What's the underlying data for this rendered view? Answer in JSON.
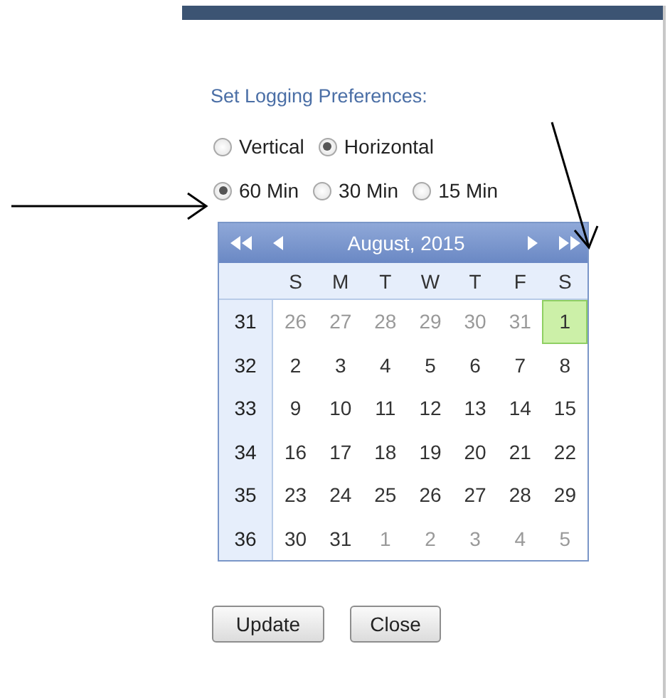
{
  "heading": "Set Logging Preferences:",
  "radio_rows": [
    [
      {
        "label": "Vertical",
        "selected": false
      },
      {
        "label": "Horizontal",
        "selected": true
      }
    ],
    [
      {
        "label": "60 Min",
        "selected": true
      },
      {
        "label": "30 Min",
        "selected": false
      },
      {
        "label": "15 Min",
        "selected": false
      }
    ]
  ],
  "calendar": {
    "title": "August, 2015",
    "weekdays": [
      "S",
      "M",
      "T",
      "W",
      "T",
      "F",
      "S"
    ],
    "weeks": [
      {
        "number": "31",
        "days": [
          {
            "day": "26",
            "other_month": true,
            "selected": false
          },
          {
            "day": "27",
            "other_month": true,
            "selected": false
          },
          {
            "day": "28",
            "other_month": true,
            "selected": false
          },
          {
            "day": "29",
            "other_month": true,
            "selected": false
          },
          {
            "day": "30",
            "other_month": true,
            "selected": false
          },
          {
            "day": "31",
            "other_month": true,
            "selected": false
          },
          {
            "day": "1",
            "other_month": false,
            "selected": true
          }
        ]
      },
      {
        "number": "32",
        "days": [
          {
            "day": "2",
            "other_month": false,
            "selected": false
          },
          {
            "day": "3",
            "other_month": false,
            "selected": false
          },
          {
            "day": "4",
            "other_month": false,
            "selected": false
          },
          {
            "day": "5",
            "other_month": false,
            "selected": false
          },
          {
            "day": "6",
            "other_month": false,
            "selected": false
          },
          {
            "day": "7",
            "other_month": false,
            "selected": false
          },
          {
            "day": "8",
            "other_month": false,
            "selected": false
          }
        ]
      },
      {
        "number": "33",
        "days": [
          {
            "day": "9",
            "other_month": false,
            "selected": false
          },
          {
            "day": "10",
            "other_month": false,
            "selected": false
          },
          {
            "day": "11",
            "other_month": false,
            "selected": false
          },
          {
            "day": "12",
            "other_month": false,
            "selected": false
          },
          {
            "day": "13",
            "other_month": false,
            "selected": false
          },
          {
            "day": "14",
            "other_month": false,
            "selected": false
          },
          {
            "day": "15",
            "other_month": false,
            "selected": false
          }
        ]
      },
      {
        "number": "34",
        "days": [
          {
            "day": "16",
            "other_month": false,
            "selected": false
          },
          {
            "day": "17",
            "other_month": false,
            "selected": false
          },
          {
            "day": "18",
            "other_month": false,
            "selected": false
          },
          {
            "day": "19",
            "other_month": false,
            "selected": false
          },
          {
            "day": "20",
            "other_month": false,
            "selected": false
          },
          {
            "day": "21",
            "other_month": false,
            "selected": false
          },
          {
            "day": "22",
            "other_month": false,
            "selected": false
          }
        ]
      },
      {
        "number": "35",
        "days": [
          {
            "day": "23",
            "other_month": false,
            "selected": false
          },
          {
            "day": "24",
            "other_month": false,
            "selected": false
          },
          {
            "day": "25",
            "other_month": false,
            "selected": false
          },
          {
            "day": "26",
            "other_month": false,
            "selected": false
          },
          {
            "day": "27",
            "other_month": false,
            "selected": false
          },
          {
            "day": "28",
            "other_month": false,
            "selected": false
          },
          {
            "day": "29",
            "other_month": false,
            "selected": false
          }
        ]
      },
      {
        "number": "36",
        "days": [
          {
            "day": "30",
            "other_month": false,
            "selected": false
          },
          {
            "day": "31",
            "other_month": false,
            "selected": false
          },
          {
            "day": "1",
            "other_month": true,
            "selected": false
          },
          {
            "day": "2",
            "other_month": true,
            "selected": false
          },
          {
            "day": "3",
            "other_month": true,
            "selected": false
          },
          {
            "day": "4",
            "other_month": true,
            "selected": false
          },
          {
            "day": "5",
            "other_month": true,
            "selected": false
          }
        ]
      }
    ]
  },
  "buttons": [
    "Update",
    "Close"
  ]
}
